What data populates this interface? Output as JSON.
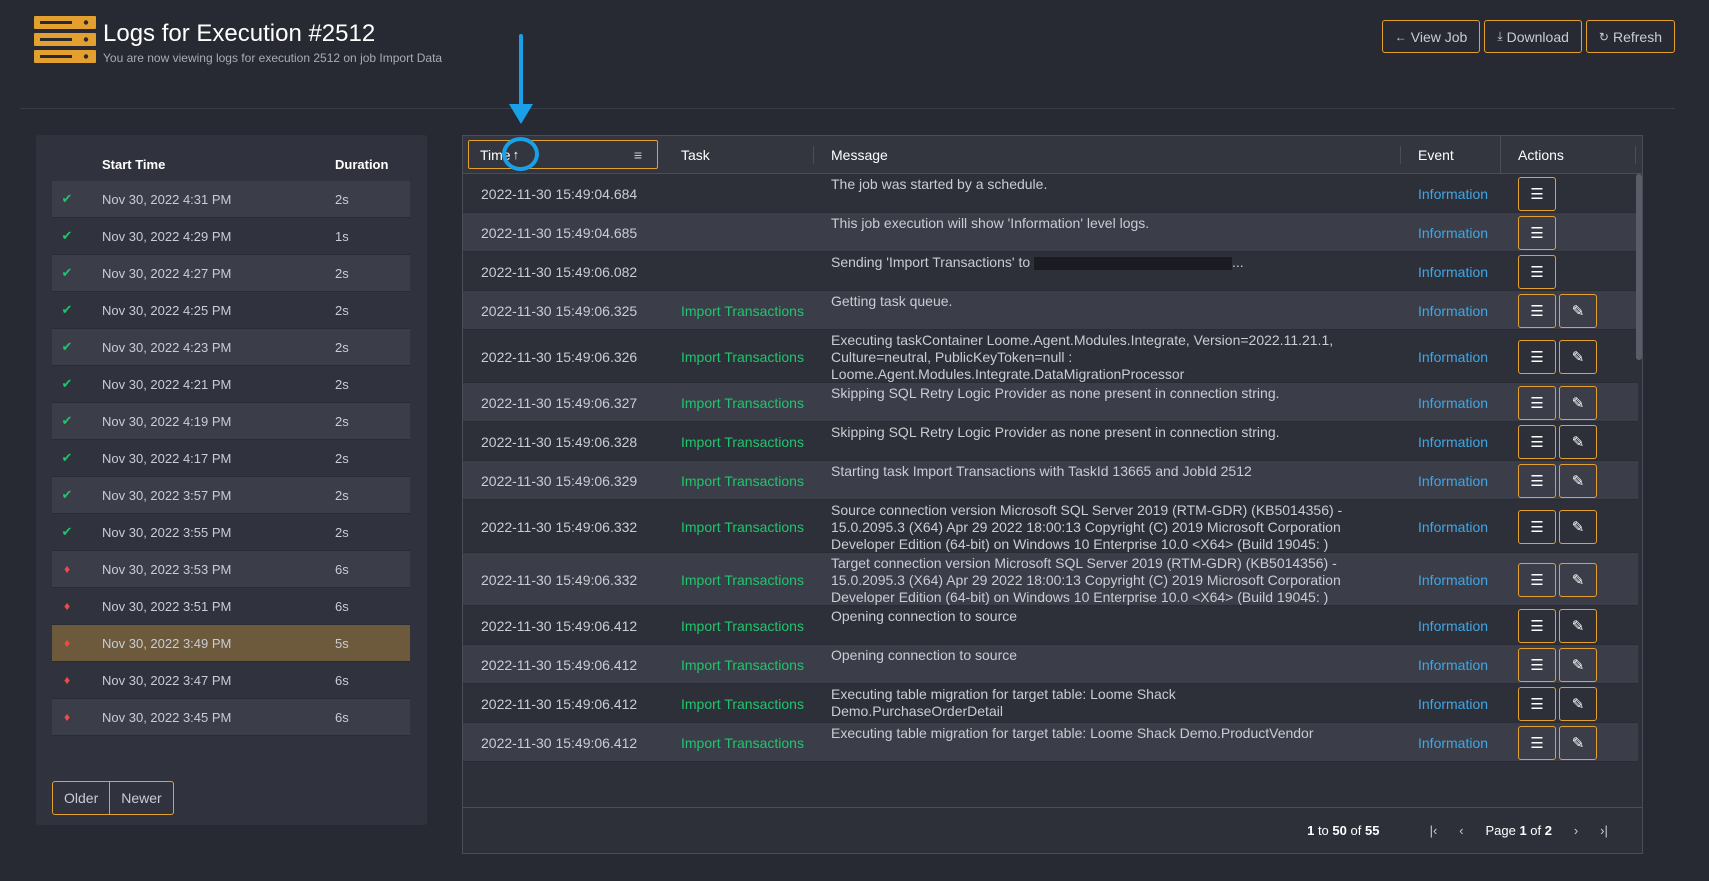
{
  "header": {
    "title": "Logs for Execution #2512",
    "subtitle": "You are now viewing logs for execution 2512 on job Import Data",
    "buttons": [
      {
        "label": "View Job",
        "icon": "arrow-left-icon",
        "glyph": "←"
      },
      {
        "label": "Download",
        "icon": "download-icon",
        "glyph": "⤓"
      },
      {
        "label": "Refresh",
        "icon": "refresh-icon",
        "glyph": "↻"
      }
    ]
  },
  "executions": {
    "col_start": "Start Time",
    "col_duration": "Duration",
    "rows": [
      {
        "status": "success",
        "time": "Nov 30, 2022 4:31 PM",
        "duration": "2s"
      },
      {
        "status": "success",
        "time": "Nov 30, 2022 4:29 PM",
        "duration": "1s"
      },
      {
        "status": "success",
        "time": "Nov 30, 2022 4:27 PM",
        "duration": "2s"
      },
      {
        "status": "success",
        "time": "Nov 30, 2022 4:25 PM",
        "duration": "2s"
      },
      {
        "status": "success",
        "time": "Nov 30, 2022 4:23 PM",
        "duration": "2s"
      },
      {
        "status": "success",
        "time": "Nov 30, 2022 4:21 PM",
        "duration": "2s"
      },
      {
        "status": "success",
        "time": "Nov 30, 2022 4:19 PM",
        "duration": "2s"
      },
      {
        "status": "success",
        "time": "Nov 30, 2022 4:17 PM",
        "duration": "2s"
      },
      {
        "status": "success",
        "time": "Nov 30, 2022 3:57 PM",
        "duration": "2s"
      },
      {
        "status": "success",
        "time": "Nov 30, 2022 3:55 PM",
        "duration": "2s"
      },
      {
        "status": "failed",
        "time": "Nov 30, 2022 3:53 PM",
        "duration": "6s"
      },
      {
        "status": "failed",
        "time": "Nov 30, 2022 3:51 PM",
        "duration": "6s"
      },
      {
        "status": "failed",
        "time": "Nov 30, 2022 3:49 PM",
        "duration": "5s",
        "selected": true
      },
      {
        "status": "failed",
        "time": "Nov 30, 2022 3:47 PM",
        "duration": "6s"
      },
      {
        "status": "failed",
        "time": "Nov 30, 2022 3:45 PM",
        "duration": "6s"
      }
    ],
    "older_label": "Older",
    "newer_label": "Newer"
  },
  "grid": {
    "columns": {
      "time": "Time",
      "task": "Task",
      "message": "Message",
      "event": "Event",
      "actions": "Actions"
    },
    "sort_icon": "arrow-up-icon",
    "rows": [
      {
        "time": "2022-11-30 15:49:04.684",
        "task": "",
        "message": "The job was started by a schedule.",
        "event": "Information",
        "edit": false,
        "h": 39
      },
      {
        "time": "2022-11-30 15:49:04.685",
        "task": "",
        "message": "This job execution will show 'Information' level logs.",
        "event": "Information",
        "edit": false,
        "h": 39
      },
      {
        "time": "2022-11-30 15:49:06.082",
        "task": "",
        "message": "Sending 'Import Transactions' to",
        "message_suffix": "...",
        "redacted": true,
        "event": "Information",
        "edit": false,
        "h": 39
      },
      {
        "time": "2022-11-30 15:49:06.325",
        "task": "Import Transactions",
        "message": "Getting task queue.",
        "event": "Information",
        "edit": true,
        "h": 39
      },
      {
        "time": "2022-11-30 15:49:06.326",
        "task": "Import Transactions",
        "message": "Executing taskContainer Loome.Agent.Modules.Integrate, Version=2022.11.21.1, Culture=neutral, PublicKeyToken=null : Loome.Agent.Modules.Integrate.DataMigrationProcessor",
        "event": "Information",
        "edit": true,
        "h": 53
      },
      {
        "time": "2022-11-30 15:49:06.327",
        "task": "Import Transactions",
        "message": "Skipping SQL Retry Logic Provider as none present in connection string.",
        "event": "Information",
        "edit": true,
        "h": 39
      },
      {
        "time": "2022-11-30 15:49:06.328",
        "task": "Import Transactions",
        "message": "Skipping SQL Retry Logic Provider as none present in connection string.",
        "event": "Information",
        "edit": true,
        "h": 39
      },
      {
        "time": "2022-11-30 15:49:06.329",
        "task": "Import Transactions",
        "message": "Starting task Import Transactions with TaskId 13665 and JobId 2512",
        "event": "Information",
        "edit": true,
        "h": 39
      },
      {
        "time": "2022-11-30 15:49:06.332",
        "task": "Import Transactions",
        "message": "Source connection version Microsoft SQL Server 2019 (RTM-GDR) (KB5014356) - 15.0.2095.3 (X64) Apr 29 2022 18:00:13 Copyright (C) 2019 Microsoft Corporation Developer Edition (64-bit) on Windows 10 Enterprise 10.0 <X64> (Build 19045: )",
        "event": "Information",
        "edit": true,
        "h": 53
      },
      {
        "time": "2022-11-30 15:49:06.332",
        "task": "Import Transactions",
        "message": "Target connection version Microsoft SQL Server 2019 (RTM-GDR) (KB5014356) - 15.0.2095.3 (X64) Apr 29 2022 18:00:13 Copyright (C) 2019 Microsoft Corporation Developer Edition (64-bit) on Windows 10 Enterprise 10.0 <X64> (Build 19045: )",
        "event": "Information",
        "edit": true,
        "h": 53
      },
      {
        "time": "2022-11-30 15:49:06.412",
        "task": "Import Transactions",
        "message": "Opening connection to source",
        "event": "Information",
        "edit": true,
        "h": 39
      },
      {
        "time": "2022-11-30 15:49:06.412",
        "task": "Import Transactions",
        "message": "Opening connection to source",
        "event": "Information",
        "edit": true,
        "h": 39
      },
      {
        "time": "2022-11-30 15:49:06.412",
        "task": "Import Transactions",
        "message": "Executing table migration for target table: Loome Shack Demo.PurchaseOrderDetail",
        "event": "Information",
        "edit": true,
        "h": 39
      },
      {
        "time": "2022-11-30 15:49:06.412",
        "task": "Import Transactions",
        "message": "Executing table migration for target table: Loome Shack Demo.ProductVendor",
        "event": "Information",
        "edit": true,
        "h": 39
      }
    ],
    "footer": {
      "range_from": "1",
      "range_to": "50",
      "range_total": "55",
      "word_to": "to",
      "word_of": "of",
      "page_word": "Page",
      "page_current": "1",
      "page_total": "2"
    }
  },
  "colors": {
    "accent": "#e4a02f",
    "success": "#21c46e",
    "failed": "#ef4a4a",
    "event": "#3fa7e6",
    "annotation": "#1aa0e8"
  }
}
